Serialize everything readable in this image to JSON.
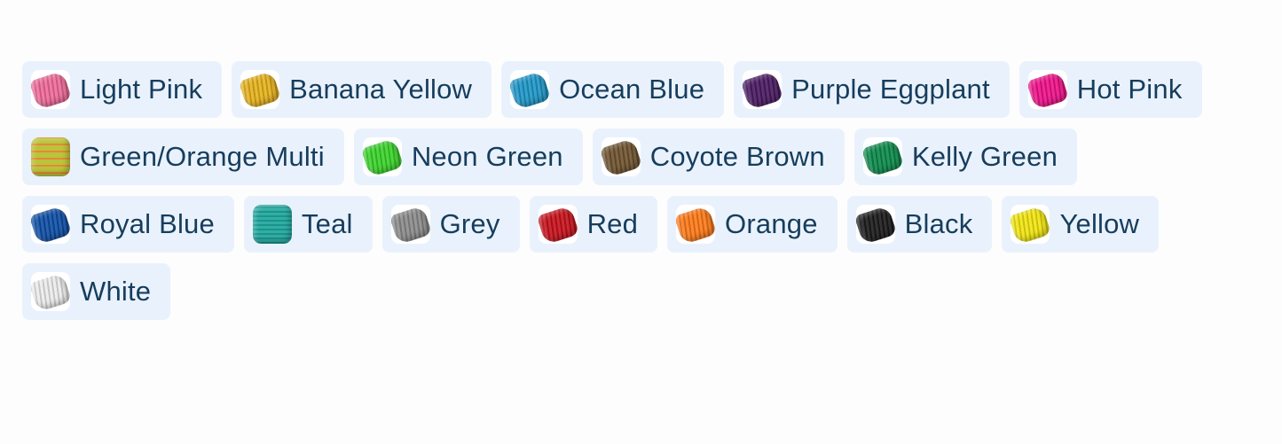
{
  "colors": [
    {
      "label": "Light Pink",
      "swatch": "#f06b9a",
      "style": "spool"
    },
    {
      "label": "Banana Yellow",
      "swatch": "#e7b21c",
      "style": "spool"
    },
    {
      "label": "Ocean Blue",
      "swatch": "#1f97c9",
      "style": "spool"
    },
    {
      "label": "Purple Eggplant",
      "swatch": "#4b1b63",
      "style": "spool"
    },
    {
      "label": "Hot Pink",
      "swatch": "#f0118a",
      "style": "spool"
    },
    {
      "label": "Green/Orange Multi",
      "swatch": "#b9c43a",
      "swatch2": "#e8863a",
      "style": "stripe"
    },
    {
      "label": "Neon Green",
      "swatch": "#3ad42b",
      "style": "spool"
    },
    {
      "label": "Coyote Brown",
      "swatch": "#6f5430",
      "style": "spool"
    },
    {
      "label": "Kelly Green",
      "swatch": "#0d8a4c",
      "style": "spool"
    },
    {
      "label": "Royal Blue",
      "swatch": "#0f4fa6",
      "style": "spool"
    },
    {
      "label": "Teal",
      "swatch": "#1fa79e",
      "style": "square"
    },
    {
      "label": "Grey",
      "swatch": "#8b8b8b",
      "style": "spool"
    },
    {
      "label": "Red",
      "swatch": "#c8121c",
      "style": "spool"
    },
    {
      "label": "Orange",
      "swatch": "#ff7a18",
      "style": "spool"
    },
    {
      "label": "Black",
      "swatch": "#1b1b1b",
      "style": "spool"
    },
    {
      "label": "Yellow",
      "swatch": "#f2e60f",
      "style": "spool"
    },
    {
      "label": "White",
      "swatch": "#ececec",
      "style": "spool"
    }
  ]
}
